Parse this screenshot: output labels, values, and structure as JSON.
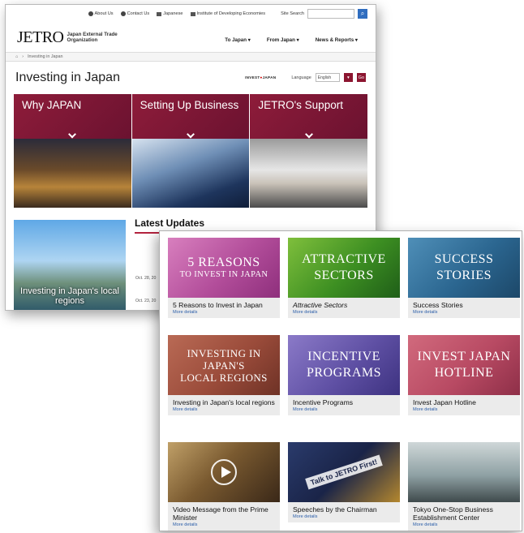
{
  "back": {
    "utility": {
      "about": "About Us",
      "contact": "Contact Us",
      "japanese": "Japanese",
      "ide": "Institute of Developing Economies",
      "search_label": "Site Search"
    },
    "logo": "JETRO",
    "logo_sub": "Japan External Trade Organization",
    "nav": [
      "To Japan ▾",
      "From Japan ▾",
      "News & Reports ▾"
    ],
    "breadcrumb": [
      "⌂",
      "›",
      "Investing in Japan"
    ],
    "page_title": "Investing in Japan",
    "invest_logo_left": "INVEST",
    "invest_logo_right": "JAPAN",
    "language_label": "Language",
    "language_value": "English",
    "go_label": "Go",
    "tiles": [
      "Why JAPAN",
      "Setting Up Business",
      "JETRO's Support"
    ],
    "local_caption": "Investing in Japan's local regions",
    "latest_title": "Latest Updates",
    "dates": [
      "Oct. 28, 20",
      "Oct. 23, 20"
    ]
  },
  "front": {
    "cards": [
      {
        "art1": "5 REASONS",
        "art2": "TO INVEST IN JAPAN",
        "label": "5 Reasons to Invest in Japan",
        "more": "More details"
      },
      {
        "art1": "ATTRACTIVE",
        "art2": "SECTORS",
        "label": "Attractive Sectors",
        "more": "More details"
      },
      {
        "art1": "SUCCESS",
        "art2": "STORIES",
        "label": "Success Stories",
        "more": "More details"
      },
      {
        "art1": "INVESTING IN JAPAN'S",
        "art2": "LOCAL REGIONS",
        "label": "Investing in Japan's local regions",
        "more": "More details"
      },
      {
        "art1": "INCENTIVE",
        "art2": "PROGRAMS",
        "label": "Incentive Programs",
        "more": "More details"
      },
      {
        "art1": "INVEST JAPAN",
        "art2": "HOTLINE",
        "label": "Invest Japan Hotline",
        "more": "More details"
      },
      {
        "label": "Video Message from the Prime Minister",
        "more": "More details"
      },
      {
        "art1": "Talk to JETRO First!",
        "label": "Speeches by the Chairman",
        "more": "More details"
      },
      {
        "label": "Tokyo One-Stop Business Establishment Center",
        "more": "More details"
      }
    ]
  }
}
